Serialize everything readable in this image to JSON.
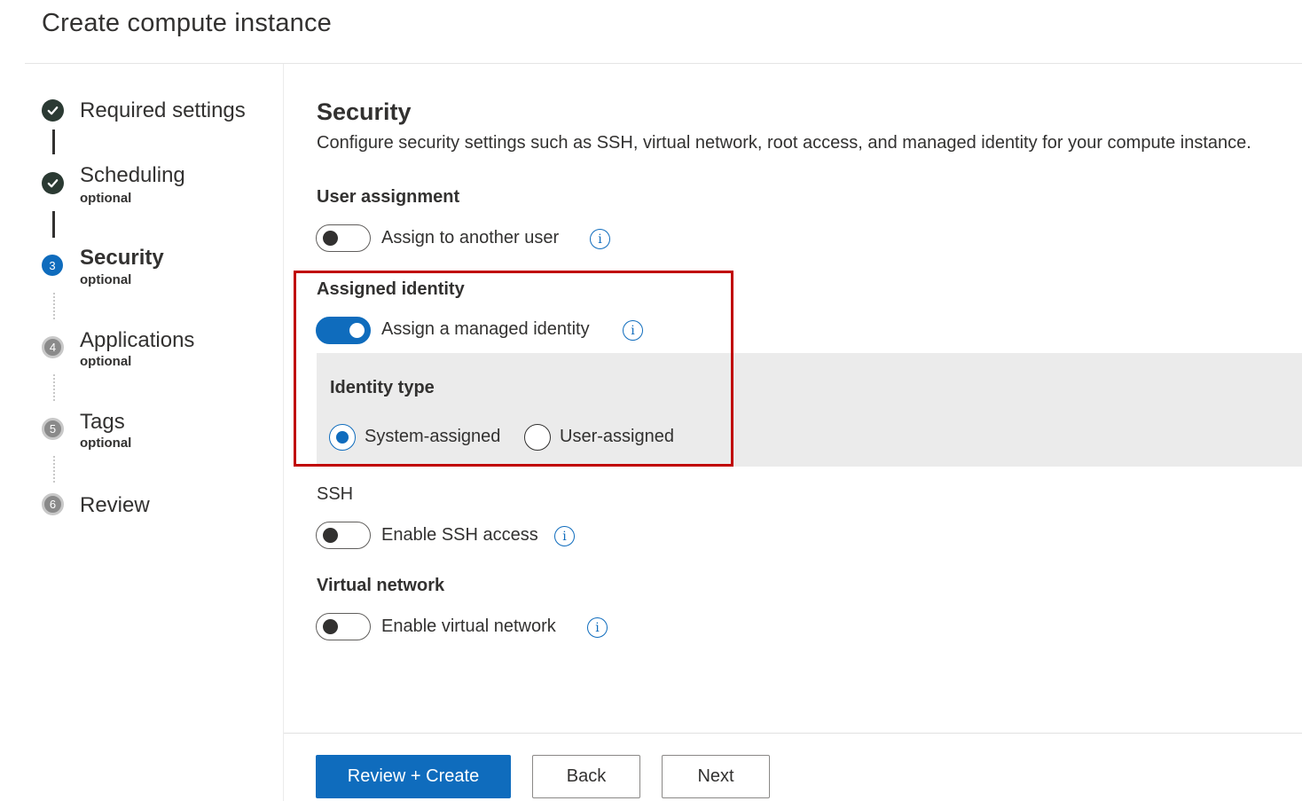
{
  "page": {
    "title": "Create compute instance"
  },
  "stepper": {
    "steps": [
      {
        "label": "Required settings",
        "sub": "",
        "state": "completed",
        "number": ""
      },
      {
        "label": "Scheduling",
        "sub": "optional",
        "state": "completed",
        "number": ""
      },
      {
        "label": "Security",
        "sub": "optional",
        "state": "current",
        "number": "3"
      },
      {
        "label": "Applications",
        "sub": "optional",
        "state": "upcoming",
        "number": "4"
      },
      {
        "label": "Tags",
        "sub": "optional",
        "state": "upcoming",
        "number": "5"
      },
      {
        "label": "Review",
        "sub": "",
        "state": "upcoming",
        "number": "6"
      }
    ]
  },
  "security": {
    "title": "Security",
    "description": "Configure security settings such as SSH, virtual network, root access, and managed identity for your compute instance.",
    "user_assignment": {
      "label": "User assignment",
      "toggle_text": "Assign to another user",
      "on": false,
      "info_icon": "info-icon"
    },
    "assigned_identity": {
      "label": "Assigned identity",
      "toggle_text": "Assign a managed identity",
      "on": true,
      "identity_type": {
        "label": "Identity type",
        "options": [
          "System-assigned",
          "User-assigned"
        ],
        "selected": "System-assigned"
      }
    },
    "ssh": {
      "label": "SSH",
      "toggle_text": "Enable SSH access",
      "on": false
    },
    "virtual_network": {
      "label": "Virtual network",
      "toggle_text": "Enable virtual network",
      "on": false
    }
  },
  "footer": {
    "review_create": "Review + Create",
    "back": "Back",
    "next": "Next"
  },
  "colors": {
    "accent": "#0f6cbd",
    "highlight": "#c00000",
    "panel": "#ebebeb"
  }
}
